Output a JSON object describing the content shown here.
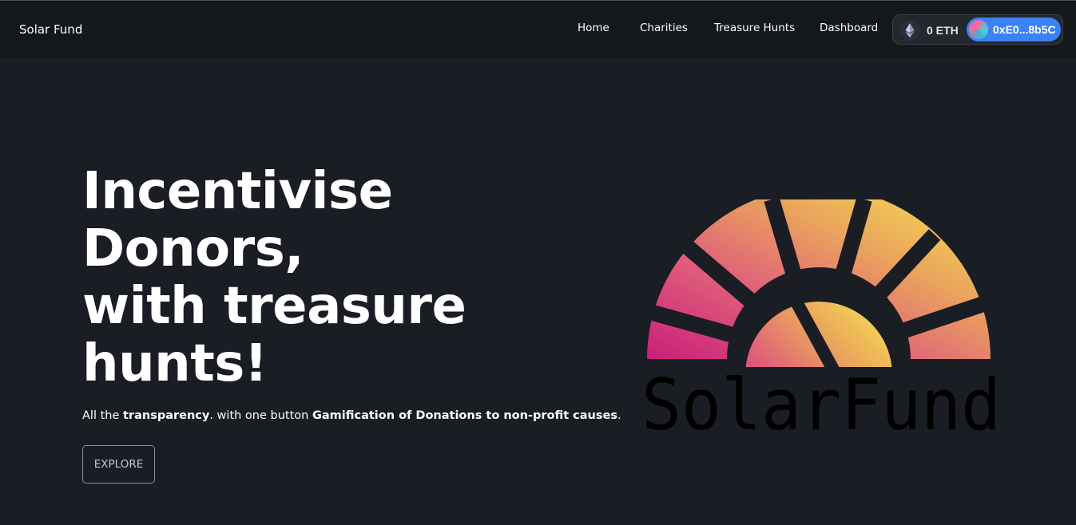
{
  "navbar": {
    "brand": "Solar Fund",
    "links": [
      "Home",
      "Charities",
      "Treasure Hunts",
      "Dashboard"
    ],
    "wallet": {
      "balance": "0 ETH",
      "address": "0xE0...8b5C",
      "eth_icon": "ethereum-icon",
      "avatar_icon": "wallet-avatar-icon"
    }
  },
  "hero": {
    "headline": [
      "Incentivise",
      "Donors,",
      "with treasure",
      "hunts!"
    ],
    "subtitle": {
      "part1": "All the ",
      "bold1": "transparency",
      "part2": ". with one button ",
      "bold2": "Gamification of Donations to non-profit causes",
      "part3": "."
    },
    "cta": "EXPLORE"
  },
  "logo": {
    "text": "SolarFund",
    "colors": {
      "magenta": "#d12f7a",
      "pink": "#e0607a",
      "orange": "#eaa55c",
      "yellow": "#f4dc55"
    }
  },
  "colors": {
    "background": "#1a1d24",
    "navbar": "#14171c",
    "address_pill": "#3b82f6"
  }
}
